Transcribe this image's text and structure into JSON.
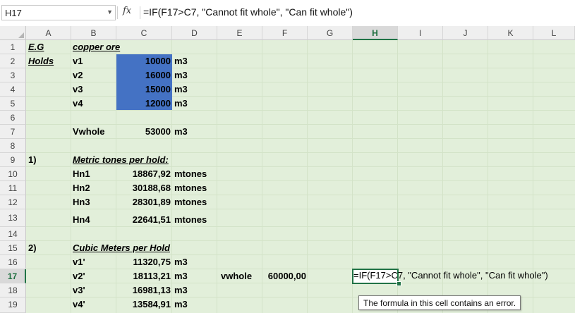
{
  "formula_bar": {
    "name_box": "H17",
    "fx_label": "fx",
    "formula": "=IF(F17>C7, \"Cannot fit whole\", \"Can fit whole\")"
  },
  "columns": [
    "A",
    "B",
    "C",
    "D",
    "E",
    "F",
    "G",
    "H",
    "I",
    "J",
    "K",
    "L"
  ],
  "active_column": "H",
  "rows": [
    "1",
    "2",
    "3",
    "4",
    "5",
    "6",
    "7",
    "8",
    "9",
    "10",
    "11",
    "12",
    "13",
    "14",
    "15",
    "16",
    "17",
    "18",
    "19"
  ],
  "active_row": "17",
  "cells": {
    "A1": "E.G",
    "B1": "copper ore",
    "A2": "Holds",
    "B2": "v1",
    "C2": "10000",
    "D2": "m3",
    "B3": "v2",
    "C3": "16000",
    "D3": "m3",
    "B4": "v3",
    "C4": "15000",
    "D4": "m3",
    "B5": "v4",
    "C5": "12000",
    "D5": "m3",
    "B7": "Vwhole",
    "C7": "53000",
    "D7": "m3",
    "A9": "1)",
    "B9": "Metric tones per hold:",
    "B10": "Hn1",
    "C10": "18867,92",
    "D10": "mtones",
    "B11": "Hn2",
    "C11": "30188,68",
    "D11": "mtones",
    "B12": "Hn3",
    "C12": "28301,89",
    "D12": "mtones",
    "B13": "Hn4",
    "C13": "22641,51",
    "D13": "mtones",
    "A15": "2)",
    "B15": "Cubic Meters per Hold",
    "B16": "v1'",
    "C16": "11320,75",
    "D16": "m3",
    "B17": "v2'",
    "C17": "18113,21",
    "D17": "m3",
    "E17": "vwhole",
    "F17": "60000,00",
    "H17_edit_part1": "=IF(F17>C7",
    "H17_edit_part2": ", \"Cannot fit whole\", \"Can fit whole\")",
    "B18": "v3'",
    "C18": "16981,13",
    "D18": "m3",
    "B19": "v4'",
    "C19": "13584,91",
    "D19": "m3"
  },
  "tooltip": "The formula in this cell contains an error.",
  "colors": {
    "fill_green": "#e2efda",
    "highlight_blue": "#4472c4",
    "accent_green": "#217346"
  }
}
